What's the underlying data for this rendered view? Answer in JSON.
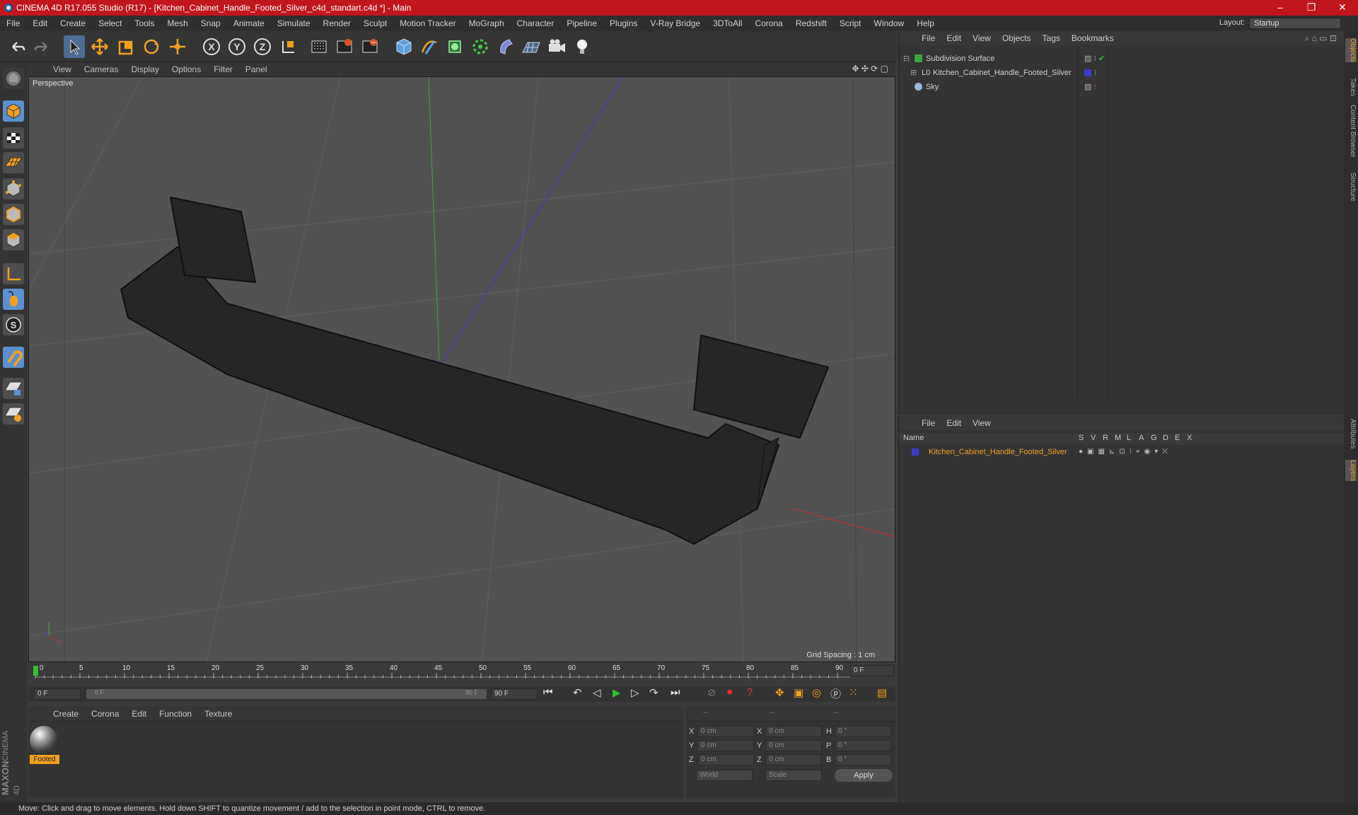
{
  "window": {
    "title": "CINEMA 4D R17.055 Studio (R17) - [Kitchen_Cabinet_Handle_Footed_Silver_c4d_standart.c4d *] - Main",
    "minimize": "–",
    "maximize": "❐",
    "close": "✕"
  },
  "menubar": {
    "items": [
      "File",
      "Edit",
      "Create",
      "Select",
      "Tools",
      "Mesh",
      "Snap",
      "Animate",
      "Simulate",
      "Render",
      "Sculpt",
      "Motion Tracker",
      "MoGraph",
      "Character",
      "Pipeline",
      "Plugins",
      "V-Ray Bridge",
      "3DToAll",
      "Corona",
      "Redshift",
      "Script",
      "Window",
      "Help"
    ],
    "layout_label": "Layout:",
    "layout_value": "Startup"
  },
  "viewport": {
    "menu": [
      "View",
      "Cameras",
      "Display",
      "Options",
      "Filter",
      "Panel"
    ],
    "label": "Perspective",
    "grid_spacing": "Grid Spacing : 1 cm"
  },
  "timeline": {
    "ticks": [
      "0",
      "5",
      "10",
      "15",
      "20",
      "25",
      "30",
      "35",
      "40",
      "45",
      "50",
      "55",
      "60",
      "65",
      "70",
      "75",
      "80",
      "85",
      "90"
    ],
    "current_frame": "0 F",
    "start_field": "0 F",
    "range_start": "0 F",
    "range_end": "90 F",
    "end_field": "90 F"
  },
  "material_panel": {
    "menu": [
      "Create",
      "Corona",
      "Edit",
      "Function",
      "Texture"
    ],
    "material_name": "Footed",
    "logo_top": "MAXON",
    "logo_bottom": "CINEMA 4D"
  },
  "coord_panel": {
    "header": [
      "--",
      "--",
      "--"
    ],
    "rows": [
      {
        "a": "X",
        "av": "0 cm",
        "b": "X",
        "bv": "0 cm",
        "c": "H",
        "cv": "0 °"
      },
      {
        "a": "Y",
        "av": "0 cm",
        "b": "Y",
        "bv": "0 cm",
        "c": "P",
        "cv": "0 °"
      },
      {
        "a": "Z",
        "av": "0 cm",
        "b": "Z",
        "bv": "0 cm",
        "c": "B",
        "cv": "0 °"
      }
    ],
    "world": "World",
    "scale": "Scale",
    "apply": "Apply"
  },
  "object_manager": {
    "menu": [
      "File",
      "Edit",
      "View",
      "Objects",
      "Tags",
      "Bookmarks"
    ],
    "objects": [
      "Subdivision Surface",
      "Kitchen_Cabinet_Handle_Footed_Silver",
      "Sky"
    ]
  },
  "layer_manager": {
    "menu": [
      "File",
      "Edit",
      "View"
    ],
    "name_header": "Name",
    "columns": [
      "S",
      "V",
      "R",
      "M",
      "L",
      "A",
      "G",
      "D",
      "E",
      "X"
    ],
    "layer_name": "Kitchen_Cabinet_Handle_Footed_Silver"
  },
  "right_tabs": [
    "Objects",
    "Takes",
    "Content Browser",
    "Structure",
    "Attributes",
    "Layers"
  ],
  "status": "Move: Click and drag to move elements. Hold down SHIFT to quantize movement / add to the selection in point mode, CTRL to remove.",
  "colors": {
    "title_bar": "#c1161c",
    "accent": "#f0a020",
    "active_tool": "#5b8fcf"
  }
}
